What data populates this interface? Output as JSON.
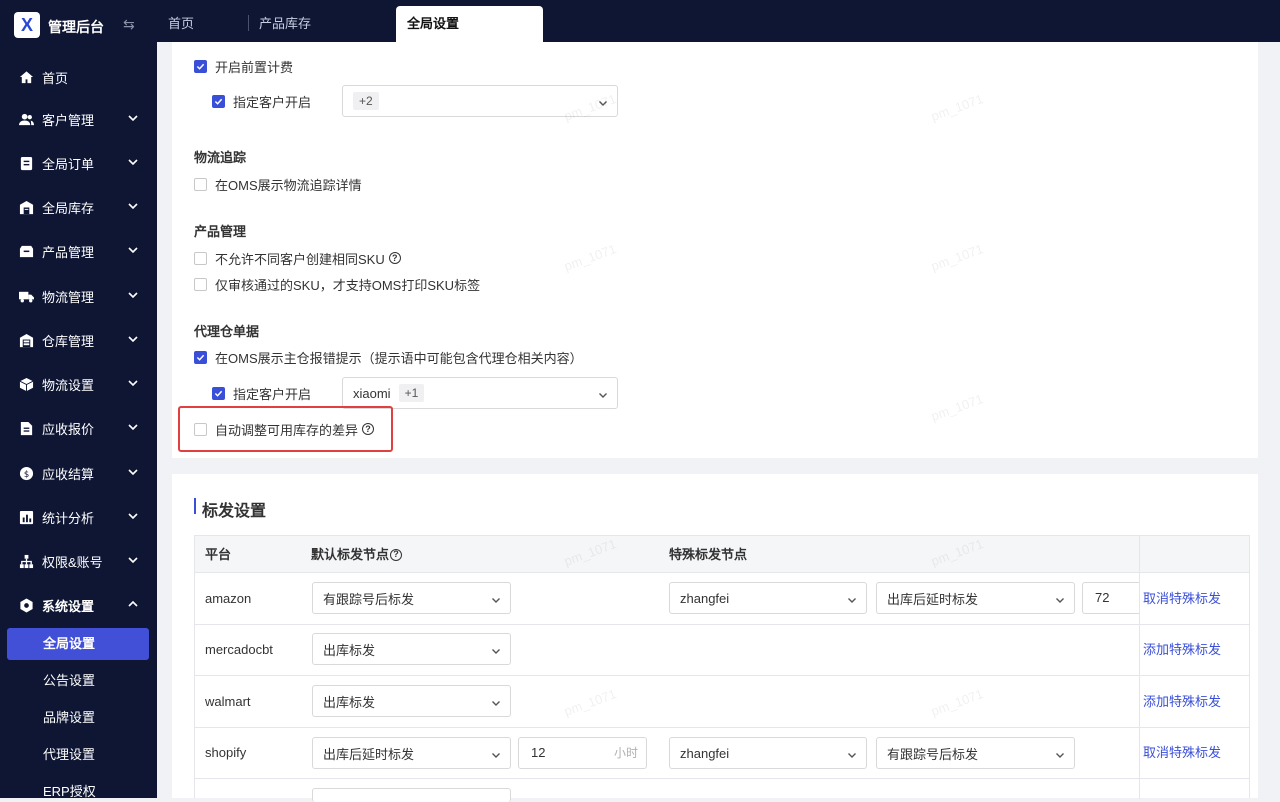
{
  "app": {
    "title": "管理后台",
    "logo_glyph": "X"
  },
  "sidebar": {
    "items": [
      {
        "label": "首页",
        "icon": "home-icon",
        "expandable": false
      },
      {
        "label": "客户管理",
        "icon": "users-icon",
        "expandable": true
      },
      {
        "label": "全局订单",
        "icon": "order-icon",
        "expandable": true
      },
      {
        "label": "全局库存",
        "icon": "warehouse-icon",
        "expandable": true
      },
      {
        "label": "产品管理",
        "icon": "product-icon",
        "expandable": true
      },
      {
        "label": "物流管理",
        "icon": "truck-icon",
        "expandable": true
      },
      {
        "label": "仓库管理",
        "icon": "storehouse-icon",
        "expandable": true
      },
      {
        "label": "物流设置",
        "icon": "cube-icon",
        "expandable": true
      },
      {
        "label": "应收报价",
        "icon": "quote-icon",
        "expandable": true
      },
      {
        "label": "应收结算",
        "icon": "coin-icon",
        "expandable": true
      },
      {
        "label": "统计分析",
        "icon": "chart-icon",
        "expandable": true
      },
      {
        "label": "权限&账号",
        "icon": "org-icon",
        "expandable": true
      },
      {
        "label": "系统设置",
        "icon": "settings-icon",
        "expandable": true,
        "expanded": true
      }
    ],
    "sub_items": [
      "全局设置",
      "公告设置",
      "品牌设置",
      "代理设置",
      "ERP授权"
    ],
    "active_sub": "全局设置"
  },
  "tabs": [
    {
      "label": "首页",
      "active": false
    },
    {
      "label": "产品库存",
      "active": false
    },
    {
      "label": "全局设置",
      "active": true
    }
  ],
  "settings": {
    "front_billing": {
      "enable_label": "开启前置计费",
      "enable_checked": true,
      "specify_label": "指定客户开启",
      "specify_checked": true,
      "select_tag": "+2"
    },
    "logistics_tracking": {
      "title": "物流追踪",
      "option_label": "在OMS展示物流追踪详情",
      "option_checked": false
    },
    "product_management": {
      "title": "产品管理",
      "option1_label": "不允许不同客户创建相同SKU",
      "option1_checked": false,
      "option2_label": "仅审核通过的SKU，才支持OMS打印SKU标签",
      "option2_checked": false
    },
    "agent_docs": {
      "title": "代理仓单据",
      "option1_label": "在OMS展示主仓报错提示（提示语中可能包含代理仓相关内容）",
      "option1_checked": true,
      "specify_label": "指定客户开启",
      "specify_checked": true,
      "select_value": "xiaomi",
      "select_tag": "+1",
      "option2_label": "自动调整可用库存的差异",
      "option2_checked": false
    }
  },
  "mark_shipping": {
    "title": "标发设置",
    "headers": {
      "platform": "平台",
      "default_node": "默认标发节点",
      "special_node": "特殊标发节点"
    },
    "rows": [
      {
        "platform": "amazon",
        "default": "有跟踪号后标发",
        "special_customer": "zhangfei",
        "special_node": "出库后延时标发",
        "special_delay": "72",
        "action": "取消特殊标发"
      },
      {
        "platform": "mercadocbt",
        "default": "出库标发",
        "action": "添加特殊标发"
      },
      {
        "platform": "walmart",
        "default": "出库标发",
        "action": "添加特殊标发"
      },
      {
        "platform": "shopify",
        "default": "出库后延时标发",
        "default_delay": "12",
        "delay_unit": "小时",
        "special_customer": "zhangfei",
        "special_node": "有跟踪号后标发",
        "action": "取消特殊标发"
      }
    ]
  },
  "watermark_text": "pm_1071",
  "colors": {
    "sidebar_bg": "#0e1634",
    "accent": "#3a4fd7",
    "active_menu": "#4250d8",
    "highlight": "#e04040"
  }
}
